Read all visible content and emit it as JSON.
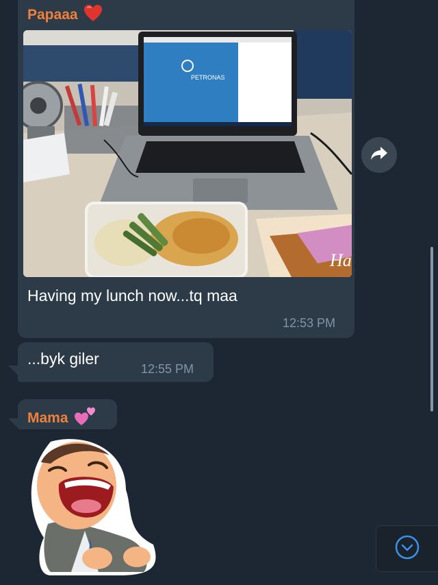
{
  "messages": {
    "photo_message": {
      "sender": "Papaaa",
      "sender_emoji": "red-heart-icon",
      "caption": "Having my lunch now...tq maa",
      "time": "12:53 PM",
      "photo": {
        "description_icons": [
          "laptop",
          "desk-fan",
          "pen-holder",
          "lunch-container",
          "greeting-card"
        ],
        "laptop_screen_brand": "PETRONAS",
        "card_text": "Ha"
      }
    },
    "text_message": {
      "text": "...byk giler",
      "time": "12:55 PM"
    },
    "sticker_message": {
      "sender": "Mama",
      "sender_emoji": "two-hearts-icon",
      "sticker": "laughing-man-sticker"
    }
  },
  "controls": {
    "forward": "forward-arrow-icon",
    "scroll_down": "chevron-down-icon"
  },
  "colors": {
    "background": "#1d2733",
    "bubble": "#2d3a48",
    "sender_name": "#f0813c",
    "timestamp": "#8495a6",
    "accent_blue": "#3a92ec"
  }
}
